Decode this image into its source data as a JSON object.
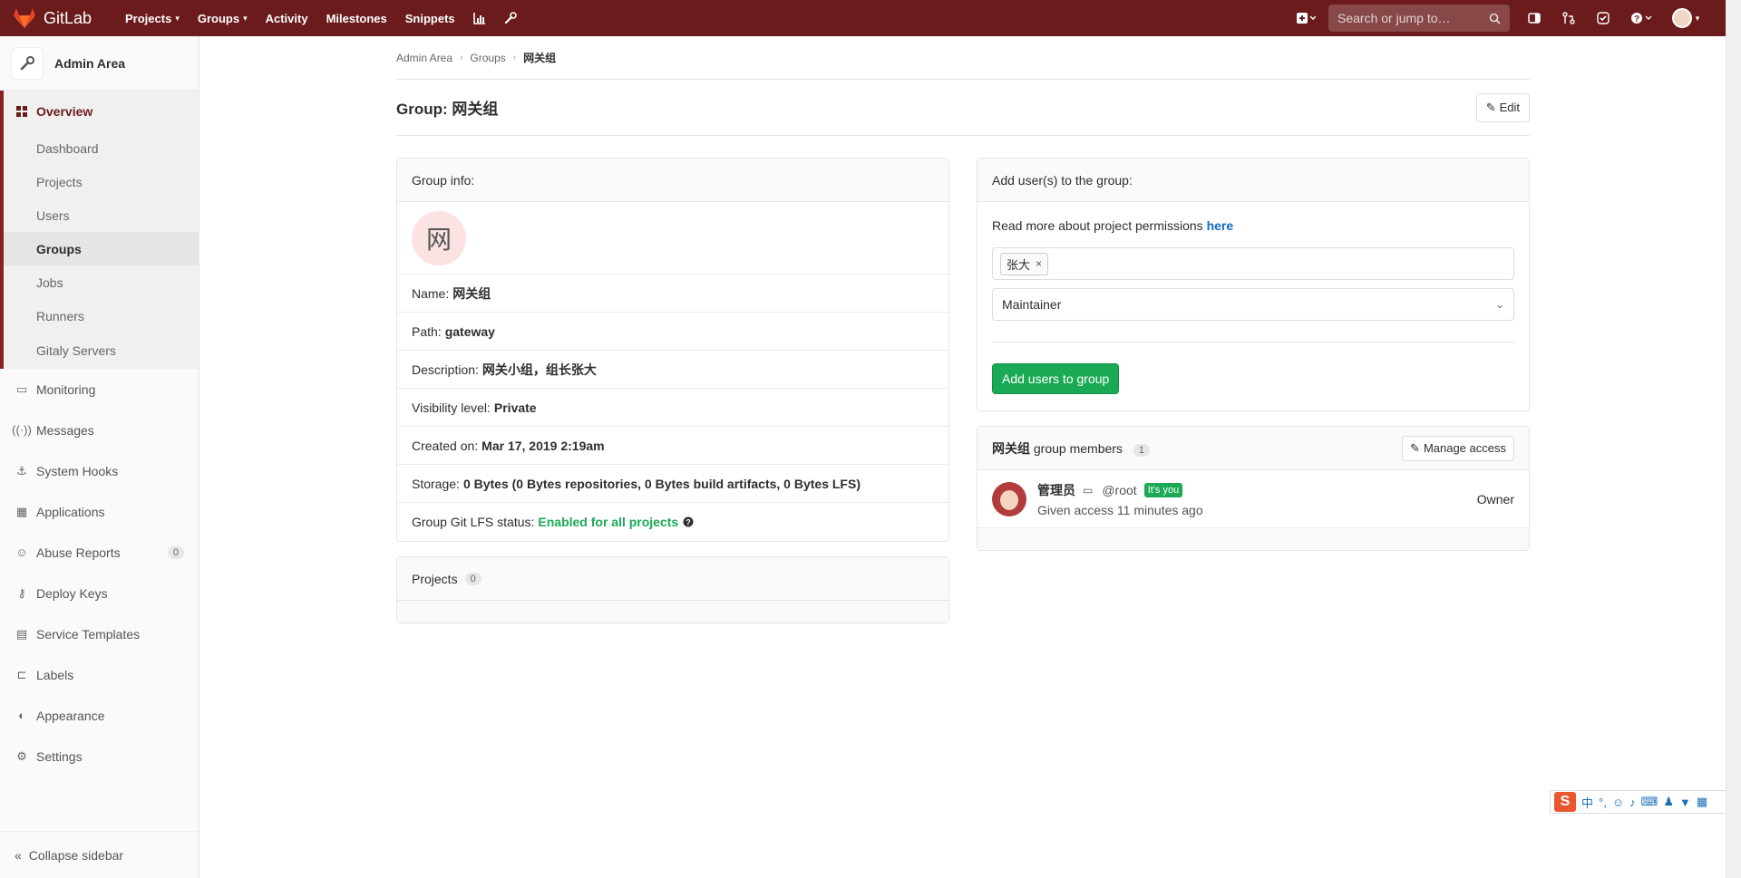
{
  "topbar": {
    "brand": "GitLab",
    "nav": [
      {
        "label": "Projects",
        "caret": true
      },
      {
        "label": "Groups",
        "caret": true
      },
      {
        "label": "Activity",
        "caret": false
      },
      {
        "label": "Milestones",
        "caret": false
      },
      {
        "label": "Snippets",
        "caret": false
      }
    ],
    "search_placeholder": "Search or jump to…"
  },
  "sidebar": {
    "title": "Admin Area",
    "overview": "Overview",
    "sub": [
      "Dashboard",
      "Projects",
      "Users",
      "Groups",
      "Jobs",
      "Runners",
      "Gitaly Servers"
    ],
    "current_sub": "Groups",
    "items": [
      {
        "label": "Monitoring",
        "icon": "monitor-icon"
      },
      {
        "label": "Messages",
        "icon": "broadcast-icon"
      },
      {
        "label": "System Hooks",
        "icon": "hook-icon"
      },
      {
        "label": "Applications",
        "icon": "grid-icon"
      },
      {
        "label": "Abuse Reports",
        "icon": "smiley-icon",
        "count": "0"
      },
      {
        "label": "Deploy Keys",
        "icon": "key-icon"
      },
      {
        "label": "Service Templates",
        "icon": "template-icon"
      },
      {
        "label": "Labels",
        "icon": "label-icon"
      },
      {
        "label": "Appearance",
        "icon": "palette-icon"
      },
      {
        "label": "Settings",
        "icon": "gear-icon"
      }
    ],
    "collapse": "Collapse sidebar"
  },
  "breadcrumb": [
    "Admin Area",
    "Groups",
    "网关组"
  ],
  "page": {
    "title": "Group: 网关组",
    "edit": "Edit"
  },
  "group_info": {
    "heading": "Group info:",
    "identicon": "网",
    "rows": [
      {
        "label": "Name:",
        "value": "网关组"
      },
      {
        "label": "Path:",
        "value": "gateway"
      },
      {
        "label": "Description:",
        "value": "网关小组，组长张大"
      },
      {
        "label": "Visibility level:",
        "value": "Private"
      },
      {
        "label": "Created on:",
        "value": "Mar 17, 2019 2:19am"
      },
      {
        "label": "Storage:",
        "value": "0 Bytes (0 Bytes repositories, 0 Bytes build artifacts, 0 Bytes LFS)"
      }
    ],
    "lfs_label": "Group Git LFS status:",
    "lfs_value": "Enabled for all projects"
  },
  "projects_panel": {
    "heading": "Projects",
    "count": "0"
  },
  "add_users": {
    "heading": "Add user(s) to the group:",
    "perm_text": "Read more about project permissions",
    "perm_link": "here",
    "token": "张大",
    "role": "Maintainer",
    "submit": "Add users to group"
  },
  "members": {
    "group_name": "网关组",
    "heading_suffix": "group members",
    "count": "1",
    "manage": "Manage access",
    "list": [
      {
        "name": "管理员",
        "username": "@root",
        "badge": "It's you",
        "access": "Given access 11 minutes ago",
        "role": "Owner"
      }
    ]
  },
  "ime": {
    "logo": "S",
    "mode": "中"
  },
  "colors": {
    "topbar": "#6b1b1b",
    "accent": "#1aaa55",
    "link": "#1068bf"
  }
}
